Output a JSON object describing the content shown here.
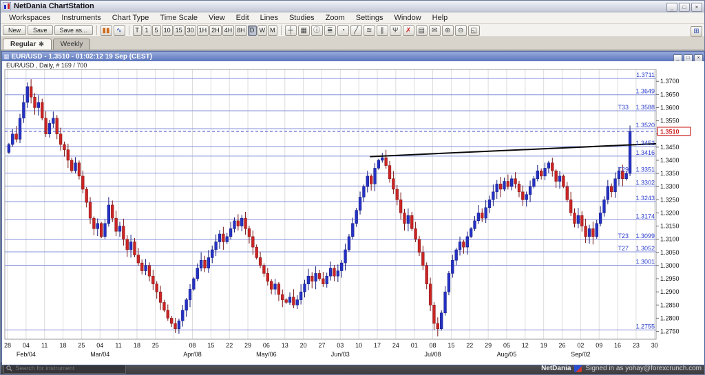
{
  "window": {
    "title": "NetDania ChartStation",
    "controls": [
      {
        "name": "minimize-button",
        "glyph": "_"
      },
      {
        "name": "maximize-button",
        "glyph": "□"
      },
      {
        "name": "close-button",
        "glyph": "×"
      }
    ]
  },
  "menubar": {
    "items": [
      "Workspaces",
      "Instruments",
      "Chart Type",
      "Time Scale",
      "View",
      "Edit",
      "Lines",
      "Studies",
      "Zoom",
      "Settings",
      "Window",
      "Help"
    ]
  },
  "toolbar": {
    "file_buttons": [
      "New",
      "Save",
      "Save as..."
    ],
    "chart_type_tools": [
      {
        "name": "candlestick-chart-icon",
        "glyph": "▮▮",
        "color": "#d06a1a"
      },
      {
        "name": "line-chart-icon",
        "glyph": "∿",
        "color": "#3a58b0"
      }
    ],
    "timeframes": [
      "T",
      "1",
      "5",
      "10",
      "15",
      "30",
      "1H",
      "2H",
      "4H",
      "8H",
      "D",
      "W",
      "M"
    ],
    "active_timeframe": "D",
    "tools": [
      {
        "name": "horizontal-line-tool-icon",
        "glyph": "┼",
        "color": "#444444"
      },
      {
        "name": "grid-toggle-icon",
        "glyph": "▦",
        "color": "#444444"
      },
      {
        "name": "info-icon",
        "glyph": "ⓘ",
        "color": "#444444"
      },
      {
        "name": "quote-panel-icon",
        "glyph": "≣",
        "color": "#444444"
      },
      {
        "name": "alert-icon",
        "glyph": "◔",
        "color": "#444444"
      },
      {
        "name": "trendline-tool-icon",
        "glyph": "╱",
        "color": "#444444"
      },
      {
        "name": "fibonacci-tool-icon",
        "glyph": "≋",
        "color": "#444444"
      },
      {
        "name": "channel-tool-icon",
        "glyph": "∥",
        "color": "#444444"
      },
      {
        "name": "pitchfork-tool-icon",
        "glyph": "Ψ",
        "color": "#444444"
      },
      {
        "name": "delete-drawings-icon",
        "glyph": "✗",
        "color": "#cc2222"
      },
      {
        "name": "print-icon",
        "glyph": "▤",
        "color": "#444444"
      },
      {
        "name": "email-chart-icon",
        "glyph": "✉",
        "color": "#444444"
      },
      {
        "name": "zoom-in-icon",
        "glyph": "⊕",
        "color": "#444444"
      },
      {
        "name": "zoom-out-icon",
        "glyph": "⊖",
        "color": "#444444"
      },
      {
        "name": "fullscreen-icon",
        "glyph": "◱",
        "color": "#444444"
      }
    ],
    "right_icon": {
      "name": "workspace-layout-icon",
      "glyph": "⊞",
      "color": "#3a58b0"
    }
  },
  "tabs": [
    {
      "label": "Regular",
      "marker": "✱",
      "active": true
    },
    {
      "label": "Weekly",
      "marker": "",
      "active": false
    }
  ],
  "chart_window": {
    "title": "EUR/USD - 1.3510 - 01:02:12  19 Sep (CEST)",
    "header_label": "EUR/USD , Daily, # 169 / 700",
    "controls": [
      {
        "name": "minimize-button",
        "glyph": "_"
      },
      {
        "name": "maximize-button",
        "glyph": "□"
      },
      {
        "name": "close-button",
        "glyph": "×"
      }
    ]
  },
  "status_bar": {
    "search_placeholder": "Search for instrument",
    "brand": "NetDania",
    "signed_in_text": "Signed in as yohay@forexcrunch.com"
  },
  "chart_data": {
    "type": "candlestick",
    "instrument": "EUR/USD",
    "timeframe": "Daily",
    "bar_count_label": "# 169 / 700",
    "current_price": 1.351,
    "ylim": [
      1.272,
      1.3745
    ],
    "first_open": 1.343,
    "closes": [
      1.346,
      1.35,
      1.348,
      1.356,
      1.362,
      1.368,
      1.364,
      1.36,
      1.362,
      1.356,
      1.35,
      1.354,
      1.356,
      1.35,
      1.346,
      1.344,
      1.34,
      1.336,
      1.339,
      1.334,
      1.329,
      1.324,
      1.318,
      1.314,
      1.316,
      1.311,
      1.316,
      1.323,
      1.318,
      1.313,
      1.315,
      1.31,
      1.306,
      1.309,
      1.304,
      1.301,
      1.298,
      1.3,
      1.296,
      1.293,
      1.29,
      1.286,
      1.283,
      1.28,
      1.278,
      1.276,
      1.279,
      1.283,
      1.287,
      1.291,
      1.295,
      1.299,
      1.302,
      1.299,
      1.303,
      1.306,
      1.309,
      1.312,
      1.309,
      1.311,
      1.314,
      1.317,
      1.315,
      1.318,
      1.314,
      1.311,
      1.307,
      1.303,
      1.3,
      1.297,
      1.294,
      1.291,
      1.293,
      1.289,
      1.287,
      1.286,
      1.288,
      1.285,
      1.287,
      1.29,
      1.293,
      1.296,
      1.294,
      1.297,
      1.295,
      1.293,
      1.296,
      1.299,
      1.296,
      1.298,
      1.301,
      1.306,
      1.311,
      1.316,
      1.321,
      1.326,
      1.33,
      1.334,
      1.331,
      1.337,
      1.34,
      1.341,
      1.338,
      1.333,
      1.329,
      1.325,
      1.32,
      1.316,
      1.319,
      1.314,
      1.31,
      1.305,
      1.3,
      1.293,
      1.285,
      1.278,
      1.276,
      1.282,
      1.29,
      1.297,
      1.302,
      1.306,
      1.309,
      1.307,
      1.311,
      1.314,
      1.317,
      1.32,
      1.318,
      1.322,
      1.325,
      1.328,
      1.331,
      1.329,
      1.332,
      1.33,
      1.333,
      1.331,
      1.328,
      1.325,
      1.327,
      1.33,
      1.333,
      1.336,
      1.334,
      1.337,
      1.339,
      1.336,
      1.332,
      1.334,
      1.33,
      1.325,
      1.32,
      1.316,
      1.319,
      1.315,
      1.311,
      1.314,
      1.311,
      1.316,
      1.32,
      1.325,
      1.33,
      1.328,
      1.333,
      1.336,
      1.333,
      1.335,
      1.351
    ],
    "price_axis_ticks": [
      "1.3700",
      "1.3650",
      "1.3600",
      "1.3550",
      "1.3500",
      "1.3450",
      "1.3400",
      "1.3350",
      "1.3300",
      "1.3250",
      "1.3200",
      "1.3150",
      "1.3100",
      "1.3050",
      "1.3000",
      "1.2950",
      "1.2900",
      "1.2850",
      "1.2800",
      "1.2750"
    ],
    "week_ticks": [
      "28",
      "04",
      "11",
      "18",
      "25",
      "04",
      "11",
      "18",
      "25",
      "",
      "08",
      "15",
      "22",
      "29",
      "06",
      "13",
      "20",
      "27",
      "03",
      "10",
      "17",
      "24",
      "01",
      "08",
      "15",
      "22",
      "29",
      "05",
      "12",
      "19",
      "26",
      "02",
      "09",
      "16",
      "23",
      "30"
    ],
    "month_labels": [
      {
        "tick": 1,
        "label": "Feb/04"
      },
      {
        "tick": 5,
        "label": "Mar/04"
      },
      {
        "tick": 10,
        "label": "Apr/08"
      },
      {
        "tick": 14,
        "label": "May/06"
      },
      {
        "tick": 18,
        "label": "Jun/03"
      },
      {
        "tick": 23,
        "label": "Jul/08"
      },
      {
        "tick": 27,
        "label": "Aug/05"
      },
      {
        "tick": 31,
        "label": "Sep/02"
      }
    ],
    "levels": [
      {
        "price": 1.3711,
        "label": "1.3711",
        "tag": ""
      },
      {
        "price": 1.3649,
        "label": "1.3649",
        "tag": ""
      },
      {
        "price": 1.3588,
        "label": "1.3588",
        "tag": "T33"
      },
      {
        "price": 1.352,
        "label": "1.3520",
        "tag": ""
      },
      {
        "price": 1.3452,
        "label": "1.3452",
        "tag": ""
      },
      {
        "price": 1.3416,
        "label": "1.3416",
        "tag": ""
      },
      {
        "price": 1.3351,
        "label": "1.3351",
        "tag": "T29"
      },
      {
        "price": 1.3302,
        "label": "1.3302",
        "tag": ""
      },
      {
        "price": 1.3243,
        "label": "1.3243",
        "tag": ""
      },
      {
        "price": 1.3174,
        "label": "1.3174",
        "tag": ""
      },
      {
        "price": 1.3099,
        "label": "1.3099",
        "tag": "T23"
      },
      {
        "price": 1.3052,
        "label": "1.3052",
        "tag": "T27"
      },
      {
        "price": 1.3001,
        "label": "1.3001",
        "tag": ""
      },
      {
        "price": 1.2755,
        "label": "1.2755",
        "tag": ""
      }
    ],
    "trendline": {
      "start_index": 98,
      "start_price": 1.3414,
      "end_price": 1.3463
    },
    "current_price_line": {
      "price": 1.351,
      "style": "dashed"
    },
    "price_box_label": "1.3510",
    "colors": {
      "up": "#2431c4",
      "up_border": "#141a7a",
      "down": "#cc2424",
      "down_border": "#7a1414",
      "level_line": "#8490dc",
      "level_label": "#2a3ccc",
      "grid": "#dcdcdc",
      "trendline": "#0a0a0a",
      "price_box": "#cc2222",
      "axis_text": "#111111"
    }
  }
}
